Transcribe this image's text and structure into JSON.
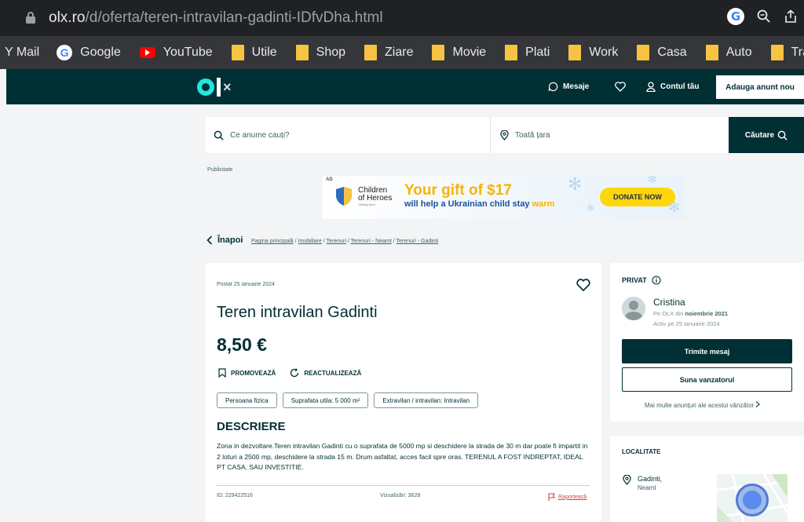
{
  "browser": {
    "url_host": "olx.ro",
    "url_path": "/d/oferta/teren-intravilan-gadinti-IDfvDha.html"
  },
  "bookmarks": [
    {
      "label": "Y Mail",
      "icon": "mail"
    },
    {
      "label": "Google",
      "icon": "google"
    },
    {
      "label": "YouTube",
      "icon": "youtube"
    },
    {
      "label": "Utile",
      "icon": "folder"
    },
    {
      "label": "Shop",
      "icon": "folder"
    },
    {
      "label": "Ziare",
      "icon": "folder"
    },
    {
      "label": "Movie",
      "icon": "folder"
    },
    {
      "label": "Plati",
      "icon": "folder"
    },
    {
      "label": "Work",
      "icon": "folder"
    },
    {
      "label": "Casa",
      "icon": "folder"
    },
    {
      "label": "Auto",
      "icon": "folder"
    },
    {
      "label": "Travel",
      "icon": "folder"
    }
  ],
  "header": {
    "messages": "Mesaje",
    "account": "Contul tău",
    "add_listing": "Adauga anunt nou"
  },
  "search": {
    "query_placeholder": "Ce anume cauți?",
    "location_placeholder": "Toată țara",
    "button": "Căutare"
  },
  "ad": {
    "label": "Publicitate",
    "tag": "AD",
    "org_line1": "Children",
    "org_line2": "of Heroes",
    "org_sub": "Charity fund",
    "headline": "Your gift of $17",
    "subline": "will help a Ukrainian child stay",
    "subline_accent": "warm",
    "cta": "DONATE NOW"
  },
  "nav": {
    "back": "Înapoi",
    "breadcrumbs": [
      "Pagina principală",
      "Imobiliare",
      "Terenuri",
      "Terenuri - Neamt",
      "Terenuri - Gadinti"
    ]
  },
  "listing": {
    "posted": "Postat 25 ianuarie 2024",
    "title": "Teren intravilan Gadinti",
    "price": "8,50 €",
    "promote": "PROMOVEAZĂ",
    "refresh": "REACTUALIZEAZĂ",
    "tags": [
      "Persoana fizica",
      "Suprafata utila: 5 000 m²",
      "Extravilan / intravilan: Intravilan"
    ],
    "description_heading": "DESCRIERE",
    "description": "Zona in dezvoltare.Teren intravilan Gadinti cu o suprafata de 5000 mp si deschidere la strada de 30 m dar poate fi impartit in 2 loturi a 2500 mp, deschidere la strada 15 m. Drum asfaltat, acces facil spre oras. TERENUL A FOST INDREPTAT, IDEAL PT CASA, SAU INVESTITIE.",
    "id": "ID: 229422516",
    "views": "Vizualizări: 3628",
    "report": "Raportează"
  },
  "seller": {
    "type": "PRIVAT",
    "name": "Cristina",
    "since_prefix": "Pe OLX din",
    "since": "noiembrie 2021",
    "active": "Activ pe 25 ianuarie 2024",
    "message_button": "Trimite mesaj",
    "call_button": "Suna vanzatorul",
    "more_ads": "Mai multe anunțuri ale acestui vânzător"
  },
  "location": {
    "heading": "LOCALITATE",
    "name": "Gadinti,",
    "county": "Neamt"
  },
  "colors": {
    "olx_dark": "#002f34",
    "olx_teal": "#23e5db",
    "donate_yellow": "#ffd60a"
  }
}
